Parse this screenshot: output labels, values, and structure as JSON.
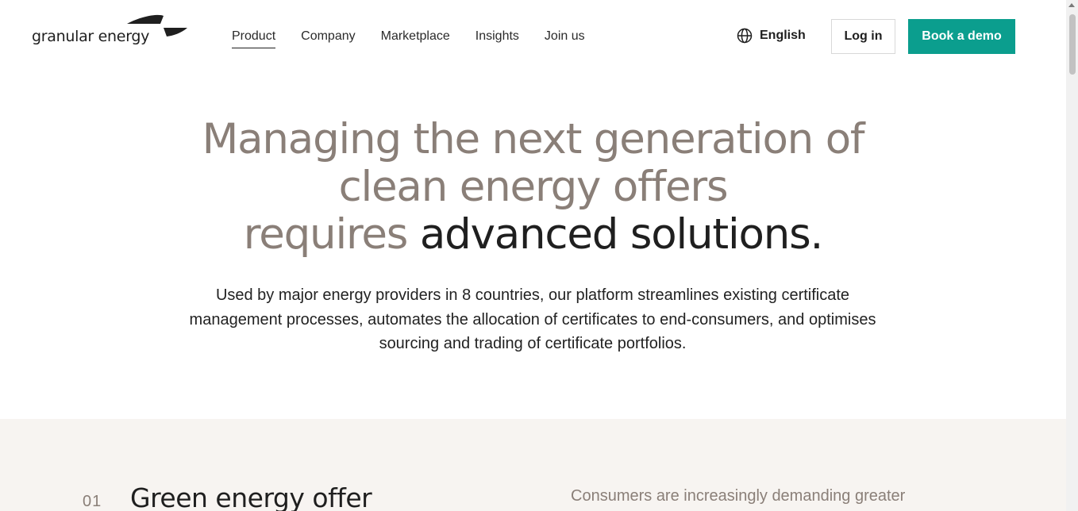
{
  "header": {
    "logo_text": "granular energy",
    "nav": [
      {
        "label": "Product",
        "active": true
      },
      {
        "label": "Company",
        "active": false
      },
      {
        "label": "Marketplace",
        "active": false
      },
      {
        "label": "Insights",
        "active": false
      },
      {
        "label": "Join us",
        "active": false
      }
    ],
    "language_label": "English",
    "language_icon": "globe-icon",
    "login_label": "Log in",
    "demo_label": "Book a demo"
  },
  "hero": {
    "title_line1": "Managing the next generation of",
    "title_line2": "clean energy offers",
    "title_line3_muted": "requires",
    "title_line3_dark": "advanced solutions.",
    "subtitle": "Used by major energy providers in 8 countries, our platform streamlines existing certificate management processes, automates the allocation of certificates to end-consumers, and optimises sourcing and trading of certificate portfolios."
  },
  "feature": {
    "number": "01",
    "title": "Green energy offer",
    "description": "Consumers are increasingly demanding greater"
  },
  "colors": {
    "accent": "#0b9e8e",
    "muted_text": "#8a7f78",
    "band_background": "#f7f4f1"
  }
}
